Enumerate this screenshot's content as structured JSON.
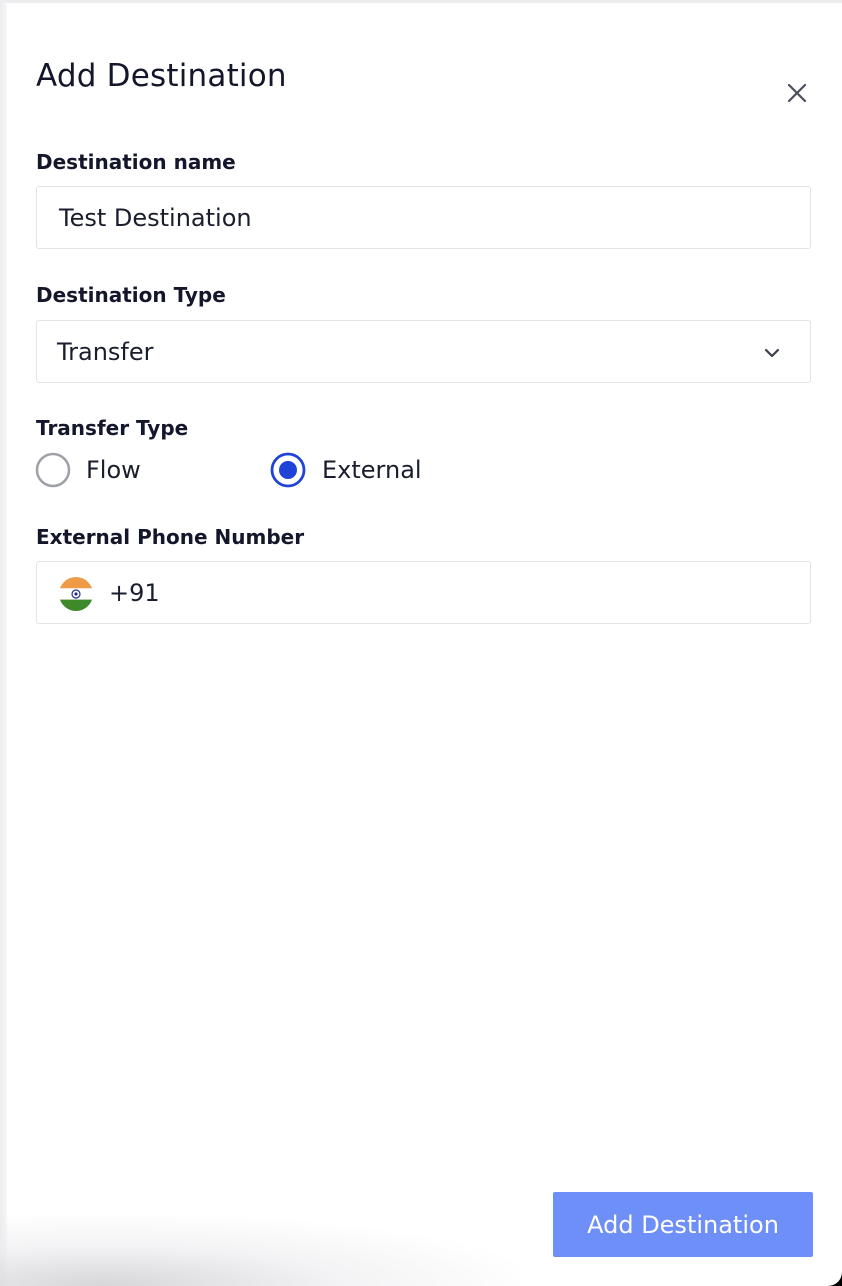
{
  "dialog": {
    "title": "Add Destination",
    "close_icon": "close-icon"
  },
  "destination_name": {
    "label": "Destination name",
    "value": "Test Destination"
  },
  "destination_type": {
    "label": "Destination Type",
    "selected": "Transfer",
    "icon": "chevron-down-icon"
  },
  "transfer_type": {
    "label": "Transfer Type",
    "options": [
      {
        "label": "Flow",
        "selected": false
      },
      {
        "label": "External",
        "selected": true
      }
    ]
  },
  "external_phone": {
    "label": "External Phone Number",
    "country_flag_icon": "india-flag-icon",
    "country_code": "+91"
  },
  "submit": {
    "label": "Add Destination"
  },
  "colors": {
    "accent": "#1f43d6",
    "button": "#6e8ff7",
    "text": "#14172b"
  }
}
